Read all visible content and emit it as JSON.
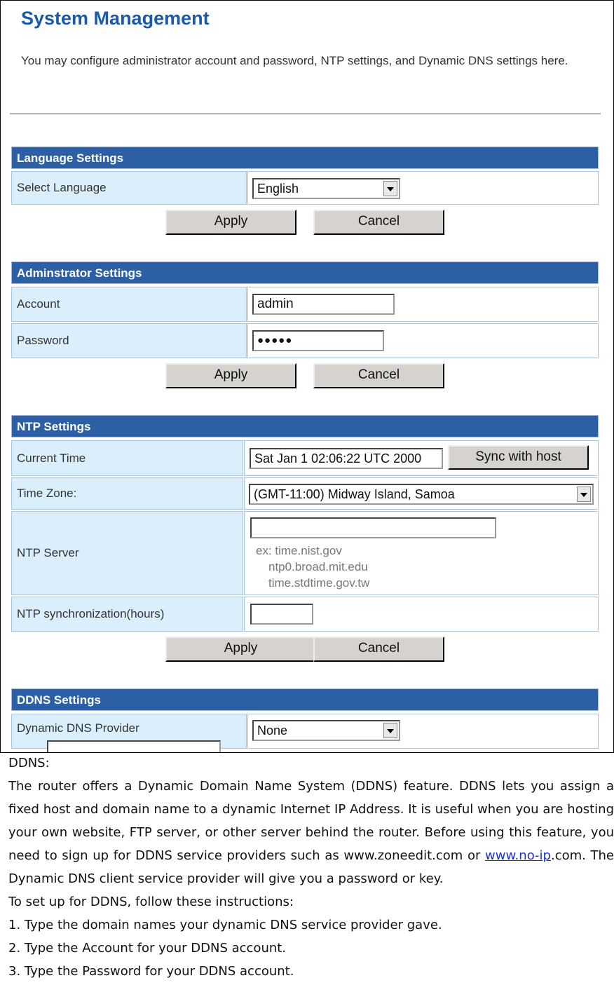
{
  "page": {
    "title": "System Management",
    "intro": "You may configure administrator account and password, NTP settings, and Dynamic DNS settings here."
  },
  "language": {
    "header": "Language Settings",
    "select_label": "Select Language",
    "select_value": "English",
    "apply": "Apply",
    "cancel": "Cancel"
  },
  "admin": {
    "header": "Adminstrator Settings",
    "account_label": "Account",
    "account_value": "admin",
    "password_label": "Password",
    "password_value": "●●●●●",
    "apply": "Apply",
    "cancel": "Cancel"
  },
  "ntp": {
    "header": "NTP Settings",
    "current_time_label": "Current Time",
    "current_time_value": "Sat Jan  1 02:06:22 UTC 2000",
    "sync_button": "Sync with host",
    "timezone_label": "Time Zone:",
    "timezone_value": "(GMT-11:00) Midway Island, Samoa",
    "server_label": "NTP Server",
    "server_value": "",
    "hints": [
      "ex: time.nist.gov",
      "ntp0.broad.mit.edu",
      "time.stdtime.gov.tw"
    ],
    "sync_hours_label": "NTP synchronization(hours)",
    "sync_hours_value": "",
    "apply": "Apply",
    "cancel": "Cancel"
  },
  "ddns": {
    "header": "DDNS Settings",
    "provider_label": "Dynamic DNS Provider",
    "provider_value": "None"
  },
  "document": {
    "heading": "DDNS:",
    "p1_before": "The router offers a Dynamic Domain Name System (DDNS) feature. DDNS lets you assign a fixed host and domain name to a dynamic Internet IP Address. It is useful when you are hosting your own website, FTP server, or other server behind the router. Before using this feature, you need to sign up for DDNS service providers such as www.zoneedit.com or ",
    "p1_link": "www.no-ip",
    "p1_after": ".com. The Dynamic DNS client service provider will give you a password or key.",
    "steps_intro": "To set up for DDNS, follow these instructions:",
    "steps": [
      "1. Type the domain names your dynamic DNS service provider gave.",
      "2. Type the Account for your DDNS account.",
      "3. Type the Password for your DDNS account."
    ]
  }
}
